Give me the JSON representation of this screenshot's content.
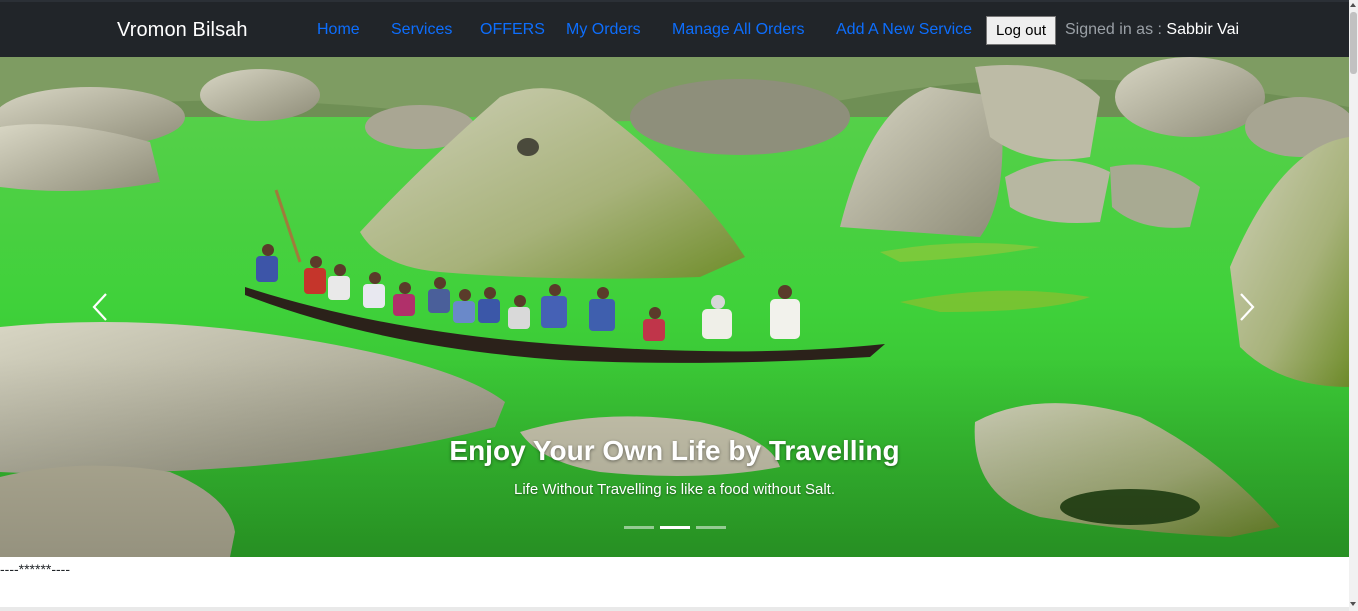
{
  "navbar": {
    "brand": "Vromon Bilsah",
    "links": [
      {
        "label": "Home"
      },
      {
        "label": "Services"
      },
      {
        "label": "OFFERS"
      },
      {
        "label": "My Orders"
      },
      {
        "label": "Manage All Orders"
      },
      {
        "label": "Add A New Service"
      }
    ],
    "logout_label": "Log out",
    "signed_in_prefix": "Signed in as : ",
    "user_name": "Sabbir Vai",
    "link_color": "#0d6efd",
    "background": "#212529"
  },
  "carousel": {
    "title": "Enjoy Your Own Life by Travelling",
    "subtitle": "Life Without Travelling is like a food without Salt.",
    "prev_icon": "chevron-left-icon",
    "next_icon": "chevron-right-icon",
    "slide_count": 3,
    "active_slide": 2,
    "scene_colors": {
      "water": "#3fd13a",
      "rock": "#b9b7a0",
      "moss": "#8fbf2f"
    }
  },
  "separator_text": "----******----"
}
